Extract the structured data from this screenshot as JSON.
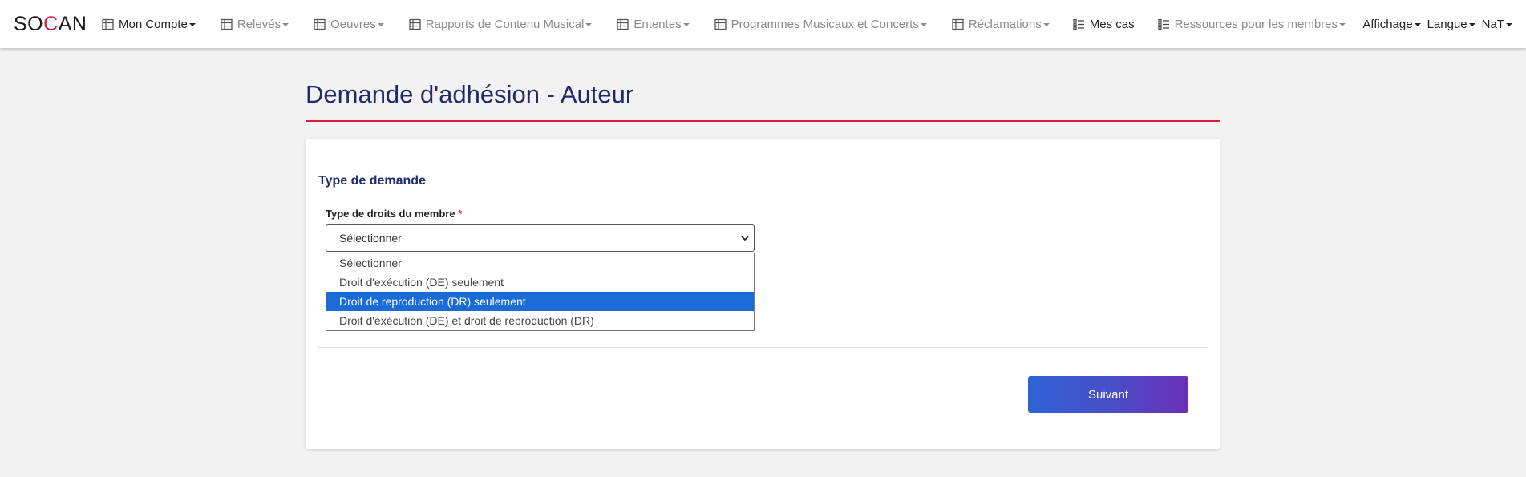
{
  "brand": {
    "logo_part1": "SO",
    "logo_part2": "C",
    "logo_part3": "AN",
    "accent": "#d6213b"
  },
  "nav": {
    "items": [
      {
        "label": "Mon Compte",
        "icon": "table-icon",
        "dark": true
      },
      {
        "label": "Relevés",
        "icon": "table-icon"
      },
      {
        "label": "Oeuvres",
        "icon": "table-icon"
      },
      {
        "label": "Rapports de Contenu Musical",
        "icon": "table-icon"
      },
      {
        "label": "Ententes",
        "icon": "table-icon"
      },
      {
        "label": "Programmes Musicaux et Concerts",
        "icon": "table-icon"
      },
      {
        "label": "Réclamations",
        "icon": "table-icon"
      },
      {
        "label": "Mes cas",
        "icon": "list-icon",
        "dark": true,
        "nocaret": true
      },
      {
        "label": "Ressources pour les membres",
        "icon": "list-icon"
      }
    ],
    "right": [
      {
        "label": "Affichage"
      },
      {
        "label": "Langue"
      },
      {
        "label": "NaT"
      }
    ]
  },
  "page": {
    "title": "Demande d'adhésion - Auteur"
  },
  "form": {
    "section_title": "Type de demande",
    "field_label": "Type de droits du membre",
    "required_mark": "*",
    "select_value": "Sélectionner",
    "options": [
      {
        "label": "Sélectionner"
      },
      {
        "label": "Droit d'exécution (DE) seulement"
      },
      {
        "label": "Droit de reproduction (DR) seulement",
        "selected": true
      },
      {
        "label": "Droit d'exécution (DE) et droit de reproduction (DR)"
      }
    ],
    "next_button": "Suivant"
  }
}
